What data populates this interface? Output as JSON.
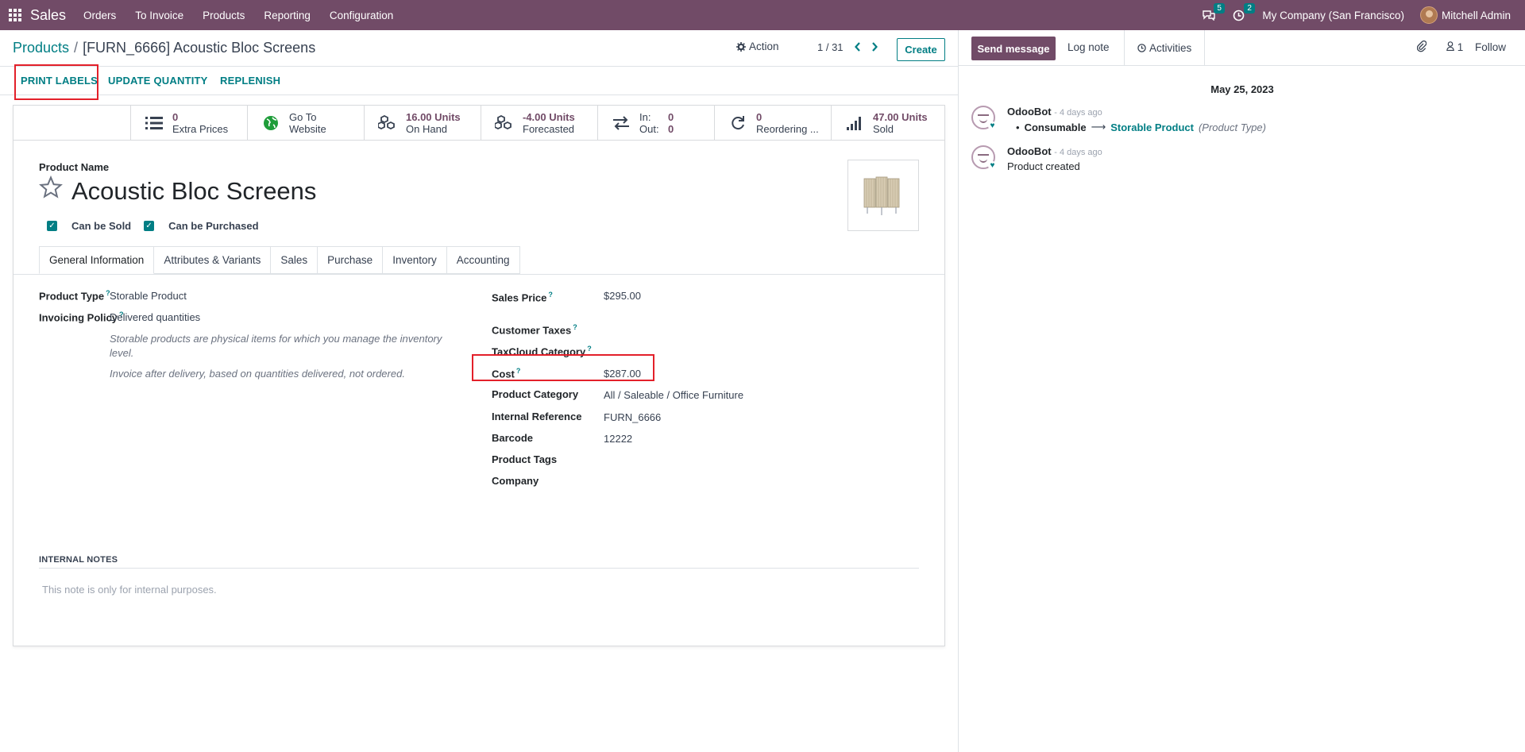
{
  "topnav": {
    "app_name": "Sales",
    "menu": [
      "Orders",
      "To Invoice",
      "Products",
      "Reporting",
      "Configuration"
    ],
    "messages_count": "5",
    "activities_count": "2",
    "company": "My Company (San Francisco)",
    "user": "Mitchell Admin",
    "bg_color": "#714b67"
  },
  "control": {
    "breadcrumb_parent": "Products",
    "breadcrumb_sep": "/",
    "breadcrumb_current": "[FURN_6666] Acoustic Bloc Screens",
    "action_label": "Action",
    "pager": "1 / 31",
    "create_label": "Create"
  },
  "statusbar": {
    "print_labels": "PRINT LABELS",
    "update_quantity": "UPDATE QUANTITY",
    "replenish": "REPLENISH"
  },
  "smart_buttons": {
    "extra_prices": {
      "value": "0",
      "label": "Extra Prices",
      "icon": "list-icon"
    },
    "website": {
      "line1": "Go To",
      "line2": "Website",
      "icon": "globe-icon"
    },
    "on_hand": {
      "value": "16.00 Units",
      "label": "On Hand",
      "icon": "cubes-icon"
    },
    "forecasted": {
      "value": "-4.00 Units",
      "label": "Forecasted",
      "icon": "cubes-icon"
    },
    "in_out": {
      "in_label": "In:",
      "in_value": "0",
      "out_label": "Out:",
      "out_value": "0",
      "icon": "exchange-icon"
    },
    "reordering": {
      "value": "0",
      "label": "Reordering ...",
      "icon": "refresh-icon"
    },
    "sold": {
      "value": "47.00 Units",
      "label": "Sold",
      "icon": "signal-icon"
    }
  },
  "product": {
    "name_label": "Product Name",
    "name": "Acoustic Bloc Screens",
    "can_be_sold": "Can be Sold",
    "can_be_purchased": "Can be Purchased"
  },
  "tabs": [
    "General Information",
    "Attributes & Variants",
    "Sales",
    "Purchase",
    "Inventory",
    "Accounting"
  ],
  "general": {
    "product_type_label": "Product Type",
    "product_type": "Storable Product",
    "invoicing_policy_label": "Invoicing Policy",
    "invoicing_policy": "Delivered quantities",
    "help_storable_1": "Storable products are physical items for which you manage the inventory",
    "help_storable_2": "level.",
    "help_invoice": "Invoice after delivery, based on quantities delivered, not ordered.",
    "sales_price_label": "Sales Price",
    "sales_price": "$295.00",
    "customer_taxes_label": "Customer Taxes",
    "taxcloud_label": "TaxCloud Category",
    "cost_label": "Cost",
    "cost": "$287.00",
    "category_label": "Product Category",
    "category": "All / Saleable / Office Furniture",
    "internal_ref_label": "Internal Reference",
    "internal_ref": "FURN_6666",
    "barcode_label": "Barcode",
    "barcode": "12222",
    "tags_label": "Product Tags",
    "company_label": "Company",
    "help_mark": "?"
  },
  "notes": {
    "heading": "INTERNAL NOTES",
    "placeholder": "This note is only for internal purposes."
  },
  "chatter": {
    "send_message": "Send message",
    "log_note": "Log note",
    "activities": "Activities",
    "followers_count": "1",
    "follow": "Follow",
    "date": "May 25, 2023",
    "messages": [
      {
        "author": "OdooBot",
        "ago": "- 4 days ago",
        "from": "Consumable",
        "to": "Storable Product",
        "field": "(Product Type)"
      },
      {
        "author": "OdooBot",
        "ago": "- 4 days ago",
        "body": "Product created"
      }
    ]
  }
}
